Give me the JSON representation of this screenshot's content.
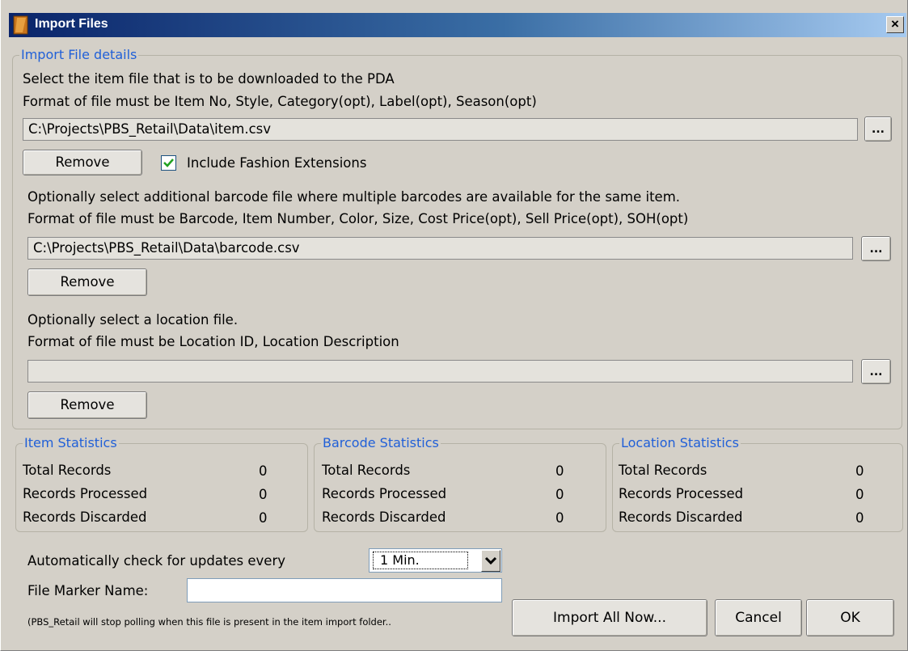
{
  "window": {
    "title": "Import Files",
    "close_label": "x"
  },
  "import_details": {
    "legend": "Import File details",
    "item": {
      "line1": "Select the item file that is to be downloaded to the PDA",
      "line2": "Format of file must be Item No, Style, Category(opt), Label(opt), Season(opt)",
      "path": "C:\\Projects\\PBS_Retail\\Data\\item.csv",
      "browse_label": "...",
      "remove_label": "Remove",
      "include_fashion_label": "Include Fashion Extensions",
      "include_fashion_checked": true
    },
    "barcode": {
      "line1": "Optionally select additional barcode file where multiple barcodes are available for the same item.",
      "line2": "Format of file must be Barcode, Item Number, Color, Size, Cost Price(opt), Sell Price(opt), SOH(opt)",
      "path": "C:\\Projects\\PBS_Retail\\Data\\barcode.csv",
      "browse_label": "...",
      "remove_label": "Remove"
    },
    "location": {
      "line1": "Optionally select a location file.",
      "line2": "Format of file must be Location ID, Location Description",
      "path": "",
      "browse_label": "...",
      "remove_label": "Remove"
    }
  },
  "stats": {
    "row_labels": [
      "Total Records",
      "Records Processed",
      "Records Discarded"
    ],
    "item": {
      "legend": "Item Statistics",
      "values": [
        "0",
        "0",
        "0"
      ]
    },
    "barcode": {
      "legend": "Barcode Statistics",
      "values": [
        "0",
        "0",
        "0"
      ]
    },
    "location": {
      "legend": "Location Statistics",
      "values": [
        "0",
        "0",
        "0"
      ]
    }
  },
  "updates": {
    "label": "Automatically check for updates every",
    "interval_value": "1 Min."
  },
  "file_marker": {
    "label": "File Marker Name:",
    "value": "",
    "note": "(PBS_Retail will stop polling when this file is present in the item import folder.."
  },
  "buttons": {
    "import_all": "Import All Now...",
    "cancel": "Cancel",
    "ok": "OK"
  },
  "colors": {
    "title_start": "#0a246a",
    "title_end": "#a6caf0",
    "legend": "#2160d8",
    "check": "#21a121"
  }
}
